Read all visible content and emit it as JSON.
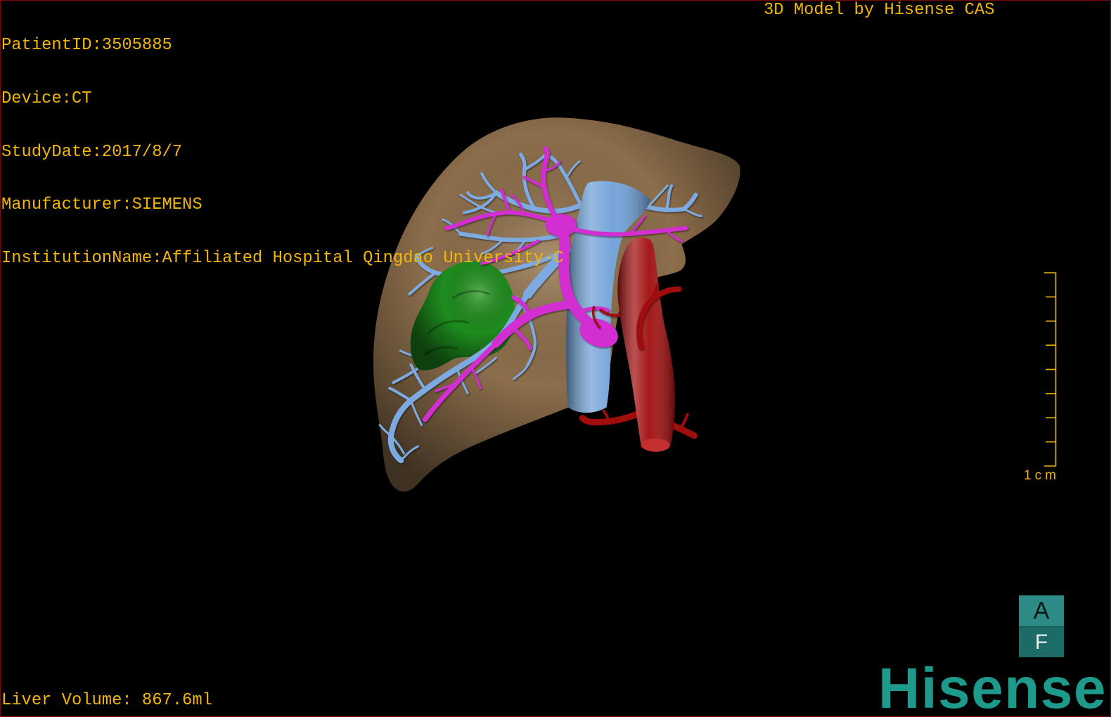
{
  "overlay": {
    "patient_id": "PatientID:3505885",
    "device": "Device:CT",
    "study_date": "StudyDate:2017/8/7",
    "manufacturer": "Manufacturer:SIEMENS",
    "institution_name": "InstitutionName:Affiliated Hospital Qingdao University-C",
    "credit": "3D Model by Hisense CAS",
    "liver_volume": "Liver Volume: 867.6ml"
  },
  "scale_bar": {
    "label": "1cm"
  },
  "orientation_cube": {
    "top": "A",
    "bottom": "F"
  },
  "logo": {
    "text": "Hisense"
  },
  "colors": {
    "background": "#000000",
    "overlay_text": "#f2b705",
    "logo": "#1d9a8b",
    "orientation_cube_top": "#2e8a84",
    "orientation_cube_bottom": "#1d6b66",
    "liver": "#8c6e4b",
    "tumor": "#1e8c1e",
    "ivc": "#6ea0d7",
    "hepatic_veins": "#7daae1",
    "portal_vein": "#d22dd2",
    "aorta": "#a00c0c"
  }
}
